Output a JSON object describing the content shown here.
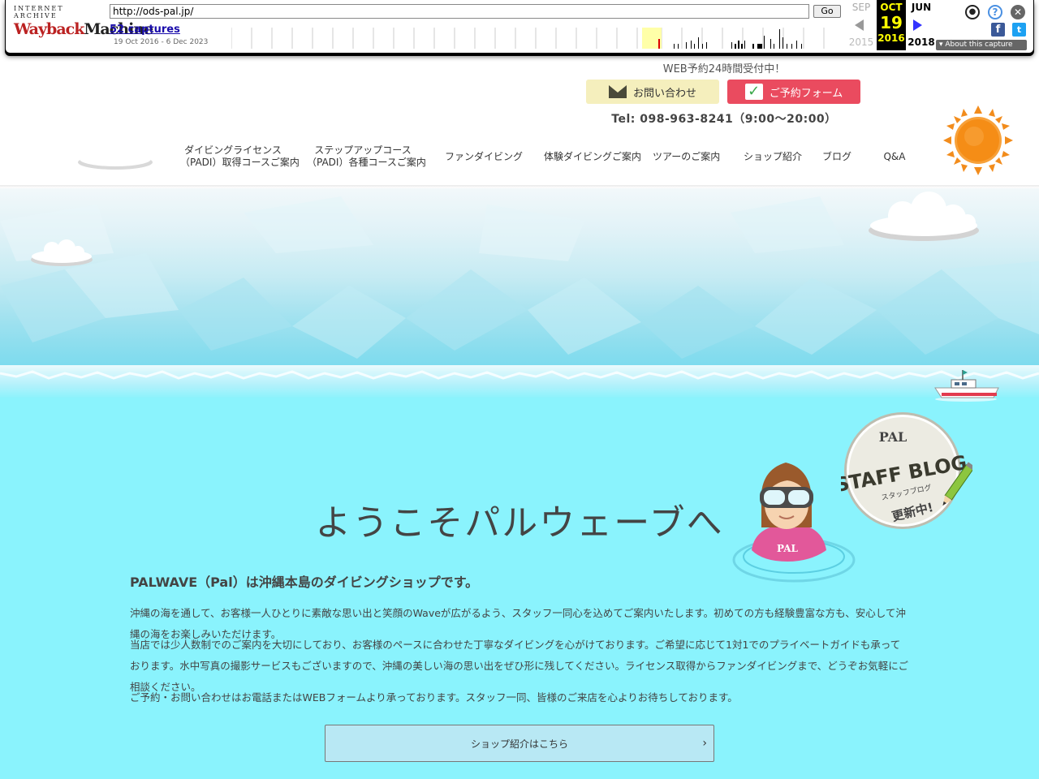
{
  "wayback": {
    "logo_top": "INTERNET ARCHIVE",
    "logo_main_left": "Wayback",
    "logo_main_right": "Machine",
    "url": "http://ods-pal.jp/",
    "go_label": "Go",
    "captures": "52 captures",
    "range": "19 Oct 2016 - 6 Dec 2023",
    "prev_month": "SEP",
    "prev_year": "2015",
    "cur_month": "OCT",
    "cur_day": "19",
    "cur_year": "2016",
    "next_month": "JUN",
    "next_year": "2018",
    "about": "About this capture",
    "icons": [
      "user-icon",
      "help-icon",
      "close-icon",
      "facebook-icon",
      "twitter-icon"
    ]
  },
  "header": {
    "top_text": "WEB予約24時間受付中！",
    "mail_label": "お問い合わせ",
    "reserve_label": "ご予約フォーム",
    "tel": "Tel: 098-963-8241（9:00〜20:00）"
  },
  "nav": [
    {
      "line1": "ダイビングライセンス",
      "line2": "（PADI）取得コースご案内"
    },
    {
      "line1": "ステップアップコース",
      "line2": "（PADI）各種コースご案内"
    },
    {
      "line1": "ファンダイビング",
      "line2": ""
    },
    {
      "line1": "体験ダイビングご案内",
      "line2": ""
    },
    {
      "line1": "ツアーのご案内",
      "line2": ""
    },
    {
      "line1": "ショップ紹介",
      "line2": ""
    },
    {
      "line1": "ブログ",
      "line2": ""
    },
    {
      "line1": "Q&A",
      "line2": ""
    }
  ],
  "badge": {
    "logo": "PAL",
    "title": "STAFF BLOG",
    "subtitle": "スタッフブログ",
    "note": "更新中!"
  },
  "diver": {
    "shirt_logo": "PAL"
  },
  "main": {
    "welcome": "ようこそパルウェーブへ",
    "intro_title": "PALWAVE（Pal）は沖縄本島のダイビングショップです。",
    "p1": "沖縄の海を通して、お客様一人ひとりに素敵な思い出と笑顔のWaveが広がるよう、スタッフ一同心を込めてご案内いたします。初めての方も経験豊富な方も、安心して沖縄の海をお楽しみいただけます。",
    "p2": "当店では少人数制でのご案内を大切にしており、お客様のペースに合わせた丁寧なダイビングを心がけております。ご希望に応じて1対1でのプライベートガイドも承っております。水中写真の撮影サービスもございますので、沖縄の美しい海の思い出をぜひ形に残してください。ライセンス取得からファンダイビングまで、どうぞお気軽にご相談ください。",
    "p3": "ご予約・お問い合わせはお電話またはWEBフォームより承っております。スタッフ一同、皆様のご来店を心よりお待ちしております。",
    "more_label": "ショップ紹介はこちら"
  }
}
